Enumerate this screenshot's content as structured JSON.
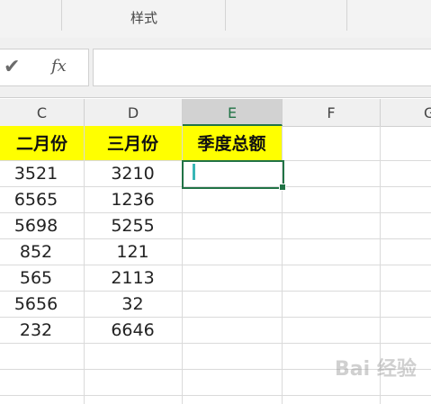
{
  "ribbon": {
    "group_label": "样式"
  },
  "formula_bar": {
    "check_icon": "checkmark-icon",
    "fx_label": "fx",
    "value": ""
  },
  "columns": [
    {
      "letter": "C",
      "active": false
    },
    {
      "letter": "D",
      "active": false
    },
    {
      "letter": "E",
      "active": true
    },
    {
      "letter": "F",
      "active": false
    },
    {
      "letter": "G",
      "active": false
    }
  ],
  "sheet": {
    "headers": [
      "二月份",
      "三月份",
      "季度总额"
    ],
    "rows": [
      [
        "3521",
        "3210",
        ""
      ],
      [
        "6565",
        "1236",
        ""
      ],
      [
        "5698",
        "5255",
        ""
      ],
      [
        "852",
        "121",
        ""
      ],
      [
        "565",
        "2113",
        ""
      ],
      [
        "5656",
        "32",
        ""
      ],
      [
        "232",
        "6646",
        ""
      ]
    ],
    "selected_cell": "E2"
  },
  "colors": {
    "header_fill": "#ffff00",
    "accent": "#217346"
  },
  "watermark": "Bai 经验"
}
